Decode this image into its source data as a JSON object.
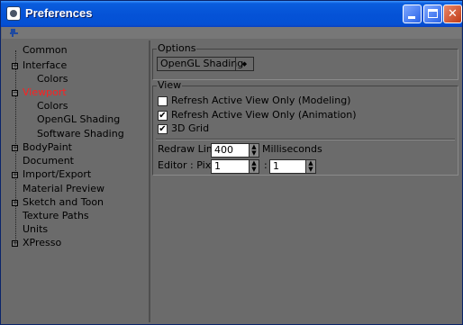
{
  "window": {
    "title": "Preferences",
    "min_symbol": "_",
    "close_symbol": "✕"
  },
  "toolbar": {
    "icon": "pin-icon"
  },
  "tree": {
    "items": [
      {
        "label": "Common"
      },
      {
        "label": "Interface"
      },
      {
        "label": "Colors"
      },
      {
        "label": "Viewport"
      },
      {
        "label": "Colors"
      },
      {
        "label": "OpenGL Shading"
      },
      {
        "label": "Software Shading"
      },
      {
        "label": "BodyPaint"
      },
      {
        "label": "Document"
      },
      {
        "label": "Import/Export"
      },
      {
        "label": "Material Preview"
      },
      {
        "label": "Sketch and Toon"
      },
      {
        "label": "Texture Paths"
      },
      {
        "label": "Units"
      },
      {
        "label": "XPresso"
      }
    ],
    "expander": "+",
    "collapser": "−"
  },
  "options": {
    "group_label": "Options",
    "mode_value": "OpenGL Shading",
    "arrow": "◆"
  },
  "view": {
    "group_label": "View",
    "refresh_modeling_label": "Refresh Active View Only (Modeling)",
    "refresh_modeling_checked": false,
    "refresh_animation_label": "Refresh Active View Only (Animation)",
    "refresh_animation_checked": true,
    "grid_label": "3D Grid",
    "grid_checked": true,
    "check_mark": "✔",
    "redraw_label": "Redraw Limit",
    "redraw_value": "400",
    "redraw_unit": "Milliseconds",
    "editor_label": "Editor : Pixel",
    "editor_x": "1",
    "editor_sep": ":",
    "editor_y": "1",
    "spin_up": "▲",
    "spin_down": "▼"
  }
}
